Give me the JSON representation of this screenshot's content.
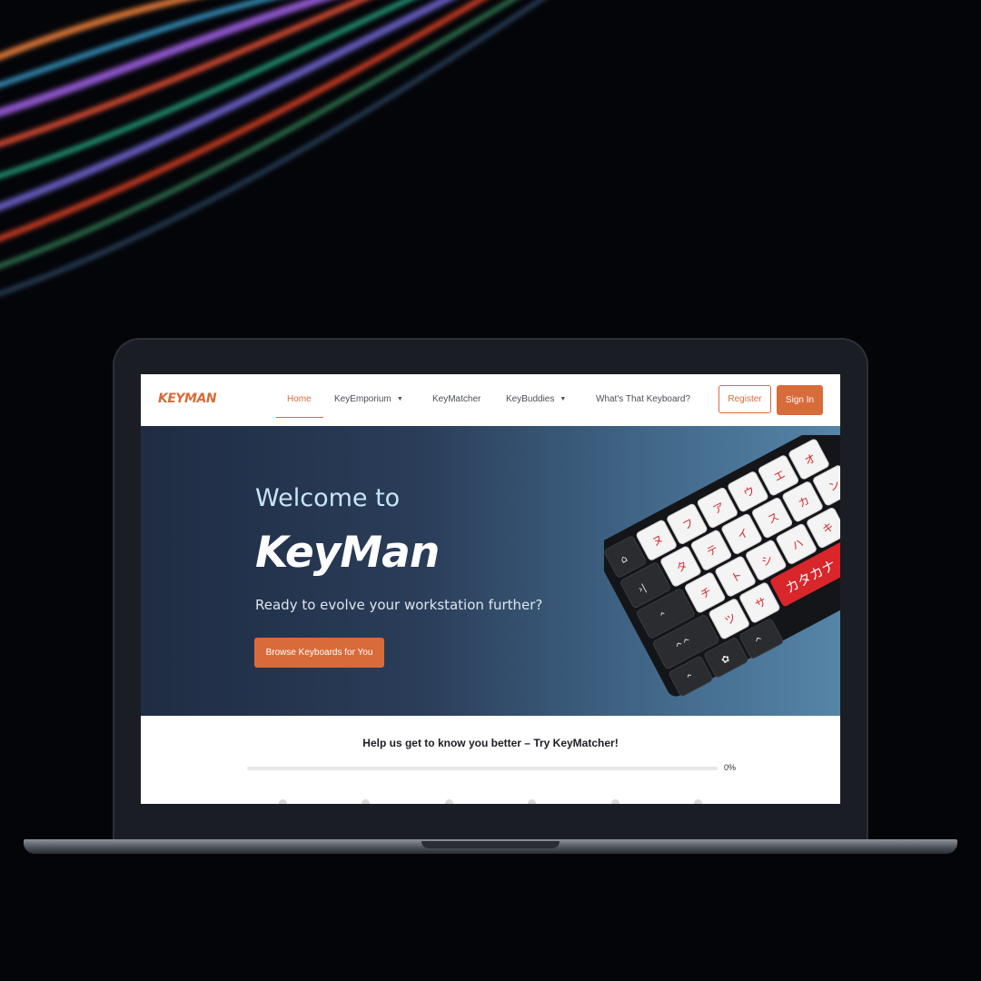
{
  "brand": {
    "logo": "KEYMAN",
    "accent_color": "#d86b3a"
  },
  "nav": {
    "items": [
      {
        "label": "Home",
        "active": true,
        "dropdown": false
      },
      {
        "label": "KeyEmporium",
        "active": false,
        "dropdown": true
      },
      {
        "label": "KeyMatcher",
        "active": false,
        "dropdown": false
      },
      {
        "label": "KeyBuddies",
        "active": false,
        "dropdown": true
      },
      {
        "label": "What's That Keyboard?",
        "active": false,
        "dropdown": false
      }
    ],
    "register_label": "Register",
    "signin_label": "Sign In"
  },
  "hero": {
    "welcome": "Welcome to",
    "title": "KeyMan",
    "subtitle": "Ready to evolve your workstation further?",
    "cta_label": "Browse Keyboards for You",
    "keycap_text": "カタカナ"
  },
  "keymatcher": {
    "heading": "Help us get to know you better – Try KeyMatcher!",
    "progress_value": 0,
    "progress_label": "0%",
    "step_count": 6
  },
  "icons": [
    "caret-down-icon",
    "keyboard-image",
    "light-streaks-image"
  ]
}
